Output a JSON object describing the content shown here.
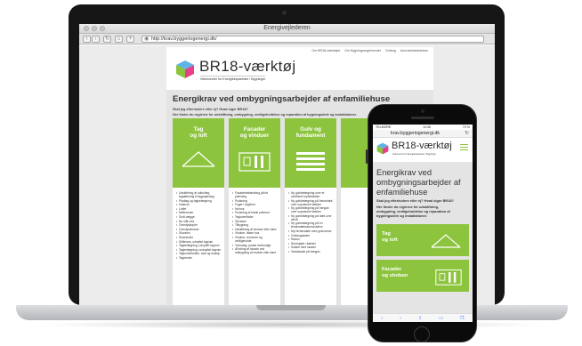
{
  "browser": {
    "window_title": "Energivejlederen",
    "url": "http://krav.byggeriogenergi.dk/"
  },
  "site": {
    "topnav": [
      "Om BR18-værktøjet",
      "Om Bygningsreglementet",
      "Ordbog",
      "Ansvarsfraskrivelse"
    ],
    "brand": "BR18-værktøj",
    "tagline": "Videncenter for Energibesparelser i Bygninger",
    "accent": "#8dc43e",
    "hero": {
      "title": "Energikrav ved ombygningsarbejder af enfamiliehuse",
      "question": "Skal jeg efterisolere eller ej? Hvad siger BR18?",
      "intro": "Her finder du reglerne for udskiftning, ombygning, vedligeholdelse og reparation af bygningsdele og installationer."
    },
    "categories": [
      {
        "title": [
          "Tag",
          "og loft"
        ],
        "icon": "roof-icon",
        "items": [
          "Udskiftning af udhuliteg tagdækning til tagpapirstag",
          "Pladtag og tagbelægning",
          "Indskud",
          "Loftet",
          "Mellemrum",
          "Skrå vægge",
          "Nu står ned",
          "Ovenlyskupler",
          "Ovenlysvinduer",
          "Skunken",
          "Skotrender",
          "Skillerum, udnyttet tagrum",
          "Tagbelægning, udnyttet tagrum",
          "Tagbelægning, uudnyttet tagrum",
          "Tagkonstruktion, skal og svømp",
          "Tagrender"
        ]
      },
      {
        "title": [
          "Facader",
          "og vinduer"
        ],
        "icon": "facade-window-icon",
        "items": [
          "Facadebeklædning på let ydervæg",
          "Pudsning",
          "Fuger i tegl/mur",
          "Hulmur",
          "Pudsning af blank ydermur",
          "Tegloverflader",
          "Terrasse",
          "Tilbygning",
          "Udskiftning af vinduer eller døre",
          "Vinduer, fastet hus",
          "Vinduer, renovere og vedligeholde",
          "Ydervæg: pudse indvendigt",
          "Ændring af facade ved indbygning af vinduer eller døre"
        ]
      },
      {
        "title": [
          "Gulv og",
          "fundament"
        ],
        "icon": "foundation-icon",
        "items": [
          "Ny gulvbelægning over et ventileret krybekælder",
          "Ny gulvbelægning på betondæk over uopvarmet kælder",
          "Ny gulvbelægning på trægulv over uopvarmet kælder",
          "Ny gulvbelægning på dæk over det fri",
          "Ny gulvbelægning på en terrændækskonstruktion",
          "Nyt terrændæk med gulvvarme",
          "Omfangsdræn",
          "Radon",
          "Rumhøjde i kælder",
          "Sokkel med skader",
          "Vandskade på trægulv"
        ]
      }
    ]
  },
  "phone": {
    "status": {
      "carrier": "TELMORE",
      "time": "11:06",
      "battery": "74 %"
    },
    "url": "krav.byggeriogenergi.dk",
    "brand": "BR18-værktøj",
    "tagline": "Videncenter for Energibesparelser i Bygninger",
    "hero_title": [
      "Energikrav ved",
      "ombygningsarbejder af",
      "enfamiliehuse"
    ],
    "question": "Skal jeg efterisolere eller ej? Hvad siger BR18?",
    "intro": [
      "Her finder du reglerne for udskiftning,",
      "ombygning, vedligeholdelse og reparation af",
      "bygningsdele og installationer."
    ],
    "cards": [
      {
        "title": [
          "Tag",
          "og loft"
        ],
        "icon": "roof-icon"
      },
      {
        "title": [
          "Facader",
          "og vinduer"
        ],
        "icon": "facade-window-icon"
      }
    ]
  }
}
